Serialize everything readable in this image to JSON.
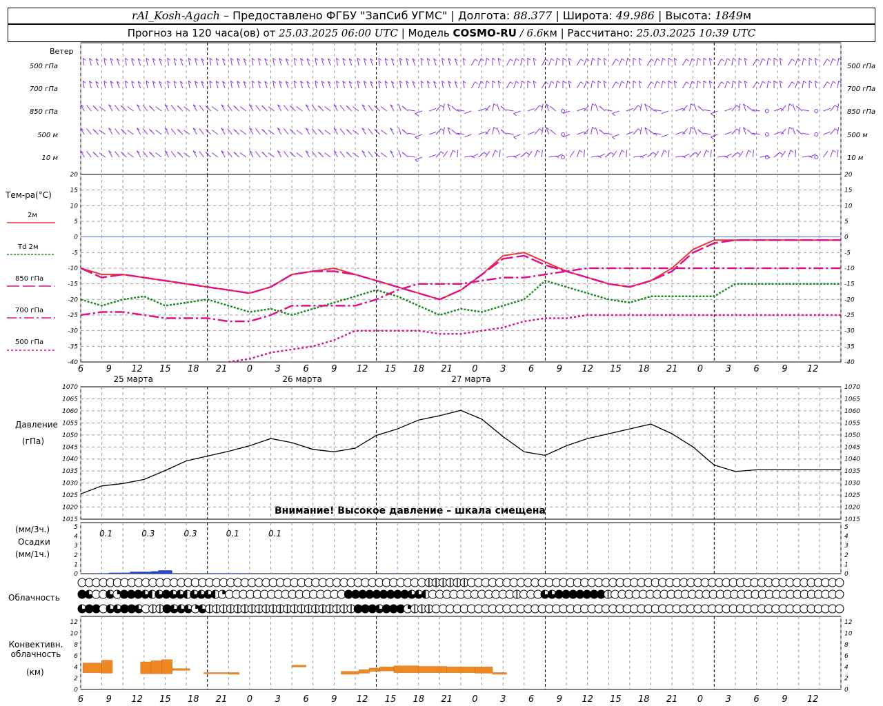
{
  "header": {
    "station": "rAl_Kosh-Agach",
    "provider": "– Предоставлено ФГБУ \"ЗапСиб УГМС\"",
    "lon_label": "Долгота:",
    "lon_value": "88.377",
    "lat_label": "Широта:",
    "lat_value": "49.986",
    "alt_label": "Высота:",
    "alt_value": "1849",
    "alt_unit": "м",
    "forecast_label": "Прогноз на 120 часа(ов) от",
    "forecast_from": "25.03.2025 06:00 UTC",
    "model_label": "Модель",
    "model_name": "COSMO-RU",
    "model_res": "/ 6.6",
    "model_res_unit": "км",
    "calc_label": "Рассчитано:",
    "calc_time": "25.03.2025 10:39 UTC"
  },
  "wind_panel": {
    "title": "Ветер",
    "levels": [
      "500 гПа",
      "700 гПа",
      "850 гПа",
      "500 м",
      "10  м"
    ]
  },
  "colors": {
    "t2m": "#ee3333",
    "td2m": "#228822",
    "t850": "#dd1188",
    "t700": "#dd1188",
    "t500": "#dd1188",
    "zero_line": "#4466ff",
    "wind": "#8833dd",
    "precip": "#2244cc",
    "convective": "#ee8822",
    "grid": "#999999"
  },
  "time_axis": {
    "tick_labels": [
      "6",
      "9",
      "12",
      "15",
      "18",
      "21",
      "0",
      "3",
      "6",
      "9",
      "12",
      "15",
      "18",
      "21",
      "0",
      "3",
      "6",
      "9",
      "12",
      "15",
      "18",
      "21",
      "0",
      "3",
      "6",
      "9",
      "12"
    ],
    "day_labels": [
      "25 марта",
      "26 марта",
      "27 марта"
    ]
  },
  "chart_data": [
    {
      "type": "line",
      "title": "Тем-ра(°C)",
      "x_hours": [
        0,
        3,
        6,
        9,
        12,
        15,
        18,
        21,
        24,
        27,
        30,
        33,
        36,
        39,
        42,
        45,
        48,
        51,
        54,
        57,
        60,
        63,
        66,
        69,
        72,
        75,
        78,
        81,
        84,
        87,
        90,
        93,
        96,
        99,
        102,
        105,
        108
      ],
      "ylim": [
        -40,
        20
      ],
      "y_ticks": [
        20,
        15,
        10,
        5,
        0,
        -5,
        -10,
        -15,
        -20,
        -25,
        -30,
        -35,
        -40
      ],
      "series": [
        {
          "name": "2м",
          "key": "t2m",
          "values": [
            -10,
            -12,
            -12,
            -13,
            -14,
            -15,
            -16,
            -17,
            -18,
            -16,
            -12,
            -11,
            -10,
            -12,
            -14,
            -16,
            -18,
            -20,
            -17,
            -12,
            -6,
            -5,
            -8,
            -11,
            -13,
            -15,
            -16,
            -14,
            -10,
            -4,
            -1,
            -1,
            -1,
            -1,
            -1,
            -1,
            -1
          ]
        },
        {
          "name": "Td  2м",
          "key": "td2m",
          "values": [
            -20,
            -22,
            -20,
            -19,
            -22,
            -21,
            -20,
            -22,
            -24,
            -23,
            -25,
            -23,
            -21,
            -19,
            -17,
            -19,
            -22,
            -25,
            -23,
            -24,
            -22,
            -20,
            -14,
            -16,
            -18,
            -20,
            -21,
            -19,
            -19,
            -19,
            -19,
            -15,
            -15,
            -15,
            -15,
            -15,
            -15
          ]
        },
        {
          "name": "850 гПа",
          "key": "t850",
          "values": [
            -10,
            -13,
            -12,
            -13,
            -14,
            -15,
            -16,
            -17,
            -18,
            -16,
            -12,
            -11,
            -11,
            -12,
            -14,
            -16,
            -18,
            -20,
            -17,
            -12,
            -7,
            -6,
            -9,
            -11,
            -13,
            -15,
            -16,
            -14,
            -11,
            -5,
            -2,
            -1,
            -1,
            -1,
            -1,
            -1,
            -1
          ]
        },
        {
          "name": "700 гПа",
          "key": "t700",
          "values": [
            -25,
            -24,
            -24,
            -25,
            -26,
            -26,
            -26,
            -27,
            -27,
            -25,
            -22,
            -22,
            -22,
            -22,
            -20,
            -17,
            -15,
            -15,
            -15,
            -14,
            -13,
            -13,
            -12,
            -11,
            -10,
            -10,
            -10,
            -10,
            -10,
            -10,
            -10,
            -10,
            -10,
            -10,
            -10,
            -10,
            -10
          ]
        },
        {
          "name": "500 гПа",
          "key": "t500",
          "values": [
            null,
            null,
            null,
            null,
            null,
            null,
            null,
            -40,
            -39,
            -37,
            -36,
            -35,
            -33,
            -30,
            -30,
            -30,
            -30,
            -31,
            -31,
            -30,
            -29,
            -27,
            -26,
            -26,
            -25,
            -25,
            -25,
            -25,
            -25,
            -25,
            -25,
            -25,
            -25,
            -25,
            -25,
            -25,
            -25
          ]
        }
      ]
    },
    {
      "type": "line",
      "title": "Давление",
      "ylabel": "(гПа)",
      "x_hours": [
        0,
        3,
        6,
        9,
        12,
        15,
        18,
        21,
        24,
        27,
        30,
        33,
        36,
        39,
        42,
        45,
        48,
        51,
        54,
        57,
        60,
        63,
        66,
        69,
        72,
        75,
        78,
        81,
        84,
        87,
        90,
        93,
        96,
        99,
        102,
        105,
        108
      ],
      "ylim": [
        1015,
        1070
      ],
      "y_ticks": [
        1070,
        1065,
        1060,
        1055,
        1050,
        1045,
        1040,
        1035,
        1030,
        1025,
        1020,
        1015
      ],
      "series": [
        {
          "name": "Давление",
          "values": [
            1025.5,
            1028.8,
            1029.8,
            1031.5,
            1035.2,
            1039.2,
            1041.2,
            1043.2,
            1045.5,
            1048.5,
            1046.8,
            1044,
            1043,
            1044.5,
            1049.8,
            1052.5,
            1056.2,
            1058,
            1060.2,
            1056.5,
            1049.3,
            1043,
            1041.5,
            1045.5,
            1048.5,
            1050.5,
            1052.5,
            1054.5,
            1050.5,
            1045,
            1037.5,
            1034.8,
            1035.5,
            1035.5,
            1035.5,
            1035.5,
            1035.5
          ]
        }
      ],
      "note": "Внимание! Высокое давление – шкала смещена"
    },
    {
      "type": "bar",
      "title": "Осадки",
      "ylabel_top": "(мм/3ч.)",
      "ylabel_bottom": "(мм/1ч.)",
      "ylim": [
        0,
        5
      ],
      "y_ticks": [
        5,
        4,
        3,
        2,
        1,
        0
      ],
      "x_hours_start": [
        0,
        1,
        2,
        3,
        4,
        5,
        6,
        7,
        8,
        9,
        10,
        11,
        12,
        13,
        14,
        15,
        16,
        17,
        18,
        19,
        20,
        21,
        22,
        23,
        24,
        25,
        26,
        27,
        28,
        29,
        30,
        31,
        32,
        33,
        34,
        35,
        36,
        37,
        38,
        39,
        40,
        41,
        42,
        43,
        44,
        45,
        46,
        47,
        48,
        49,
        50,
        51,
        52,
        53,
        54,
        55,
        56,
        57,
        58,
        59,
        60,
        61,
        62,
        63,
        64,
        65,
        66,
        67,
        68,
        69,
        70,
        71,
        72,
        73,
        74,
        75,
        76,
        77,
        78,
        79,
        80,
        81,
        82,
        83,
        84,
        85,
        86,
        87,
        88,
        89,
        90,
        91,
        92,
        93,
        94,
        95,
        96,
        97,
        98,
        99,
        100,
        101,
        102,
        103,
        104,
        105,
        106,
        107,
        108
      ],
      "values": [
        0,
        0,
        0.05,
        0.05,
        0.1,
        0.1,
        0.1,
        0.2,
        0.2,
        0.2,
        0.25,
        0.35,
        0.35,
        0,
        0,
        0,
        0,
        0.05,
        0.05,
        0.05,
        0.05,
        0.05,
        0.05,
        0.05,
        0,
        0,
        0,
        0,
        0,
        0,
        0,
        0,
        0,
        0,
        0,
        0,
        0,
        0,
        0,
        0,
        0,
        0,
        0,
        0,
        0.05,
        0,
        0,
        0,
        0,
        0,
        0,
        0,
        0,
        0,
        0,
        0,
        0,
        0,
        0,
        0,
        0,
        0,
        0,
        0,
        0,
        0,
        0,
        0,
        0,
        0,
        0,
        0,
        0,
        0,
        0,
        0,
        0,
        0,
        0,
        0,
        0,
        0,
        0,
        0,
        0,
        0,
        0,
        0,
        0,
        0,
        0,
        0,
        0,
        0,
        0,
        0,
        0,
        0,
        0,
        0,
        0,
        0,
        0,
        0,
        0,
        0,
        0,
        0,
        0,
        0
      ],
      "sum_labels": [
        {
          "hour": 3,
          "text": "0.1"
        },
        {
          "hour": 9,
          "text": "0.3"
        },
        {
          "hour": 15,
          "text": "0.3"
        },
        {
          "hour": 21,
          "text": "0.1"
        },
        {
          "hour": 27,
          "text": "0.1"
        }
      ]
    },
    {
      "type": "table",
      "title": "Облачность",
      "symbol_legend": "0=clear, 1=quarter, 2=half, 3=three-quarters, 4=overcast, 5=vertical-half",
      "rows": [
        [
          0,
          0,
          0,
          0,
          0,
          0,
          0,
          0,
          0,
          0,
          0,
          0,
          0,
          0,
          0,
          0,
          0,
          0,
          0,
          0,
          0,
          0,
          0,
          0,
          0,
          0,
          0,
          0,
          0,
          0,
          0,
          0,
          0,
          0,
          0,
          0,
          0,
          0,
          0,
          0,
          0,
          0,
          0,
          0,
          0,
          0,
          0,
          0,
          0,
          5,
          5,
          5,
          5,
          5,
          5,
          0,
          0,
          0,
          0,
          0,
          0,
          0,
          0,
          0,
          0,
          0,
          0,
          0,
          0,
          0,
          0,
          0,
          0,
          0,
          0,
          0,
          0,
          0,
          0,
          0,
          0,
          0,
          0,
          0,
          0,
          0,
          0,
          0,
          0,
          0,
          0,
          0,
          0,
          0,
          0,
          0,
          0,
          0,
          0,
          0,
          0,
          0,
          0,
          0,
          0,
          0,
          0,
          0
        ],
        [
          4,
          3,
          0,
          0,
          3,
          1,
          4,
          4,
          4,
          3,
          2,
          3,
          4,
          3,
          3,
          2,
          3,
          3,
          3,
          2,
          1,
          0,
          0,
          0,
          0,
          0,
          0,
          0,
          0,
          0,
          0,
          0,
          0,
          0,
          0,
          0,
          0,
          0,
          4,
          4,
          4,
          4,
          4,
          4,
          4,
          4,
          4,
          3,
          3,
          2,
          0,
          0,
          0,
          0,
          0,
          0,
          0,
          0,
          0,
          0,
          0,
          0,
          5,
          0,
          0,
          0,
          3,
          3,
          4,
          4,
          4,
          4,
          4,
          4,
          4,
          5,
          0,
          0,
          0,
          0,
          0,
          0,
          0,
          0,
          0,
          0,
          0,
          0,
          0,
          0,
          0,
          0,
          0,
          0,
          0,
          0,
          0,
          0,
          0,
          0,
          0,
          0,
          0,
          0,
          0,
          0,
          0,
          0,
          0
        ],
        [
          3,
          4,
          4,
          0,
          3,
          3,
          4,
          4,
          3,
          0,
          5,
          5,
          4,
          3,
          3,
          3,
          1,
          3,
          5,
          5,
          5,
          5,
          5,
          5,
          5,
          5,
          5,
          5,
          5,
          5,
          5,
          5,
          5,
          5,
          5,
          5,
          5,
          5,
          5,
          4,
          4,
          4,
          3,
          4,
          4,
          4,
          1,
          5,
          5,
          5,
          0,
          0,
          0,
          0,
          0,
          0,
          0,
          0,
          0,
          0,
          0,
          0,
          0,
          0,
          0,
          0,
          0,
          0,
          0,
          0,
          0,
          0,
          0,
          0,
          0,
          0,
          0,
          0,
          0,
          0,
          0,
          0,
          0,
          0,
          0,
          0,
          0,
          0,
          0,
          0,
          0,
          0,
          0,
          0,
          0,
          0,
          0,
          0,
          0,
          0,
          0,
          0,
          0,
          0,
          0,
          0,
          0,
          0
        ]
      ]
    },
    {
      "type": "bar",
      "title": "Конвективн. облачность",
      "ylabel": "(км)",
      "ylim": [
        0,
        13
      ],
      "y_ticks": [
        12,
        10,
        8,
        6,
        4,
        2,
        0
      ],
      "bars": [
        {
          "x0": 0.3,
          "x1": 3.0,
          "bottom": 3.0,
          "top": 4.7
        },
        {
          "x0": 3.0,
          "x1": 4.5,
          "bottom": 2.9,
          "top": 5.2
        },
        {
          "x0": 8.5,
          "x1": 10.0,
          "bottom": 2.8,
          "top": 4.9
        },
        {
          "x0": 10.0,
          "x1": 11.5,
          "bottom": 2.8,
          "top": 5.1
        },
        {
          "x0": 11.5,
          "x1": 13.0,
          "bottom": 2.8,
          "top": 5.3
        },
        {
          "x0": 13.0,
          "x1": 15.5,
          "bottom": 3.4,
          "top": 3.7
        },
        {
          "x0": 17.5,
          "x1": 21.0,
          "bottom": 2.8,
          "top": 3.0
        },
        {
          "x0": 21.0,
          "x1": 22.5,
          "bottom": 2.7,
          "top": 3.0
        },
        {
          "x0": 30.0,
          "x1": 32.0,
          "bottom": 4.0,
          "top": 4.3
        },
        {
          "x0": 37.0,
          "x1": 39.5,
          "bottom": 2.7,
          "top": 3.2
        },
        {
          "x0": 39.5,
          "x1": 41.0,
          "bottom": 2.9,
          "top": 3.5
        },
        {
          "x0": 41.0,
          "x1": 42.5,
          "bottom": 3.2,
          "top": 3.8
        },
        {
          "x0": 42.5,
          "x1": 44.5,
          "bottom": 3.3,
          "top": 4.0
        },
        {
          "x0": 44.5,
          "x1": 48.0,
          "bottom": 3.0,
          "top": 4.2
        },
        {
          "x0": 48.0,
          "x1": 52.0,
          "bottom": 3.0,
          "top": 4.1
        },
        {
          "x0": 52.0,
          "x1": 56.0,
          "bottom": 3.0,
          "top": 4.0
        },
        {
          "x0": 56.0,
          "x1": 58.5,
          "bottom": 2.9,
          "top": 4.0
        },
        {
          "x0": 58.5,
          "x1": 60.5,
          "bottom": 2.7,
          "top": 3.0
        }
      ]
    }
  ]
}
